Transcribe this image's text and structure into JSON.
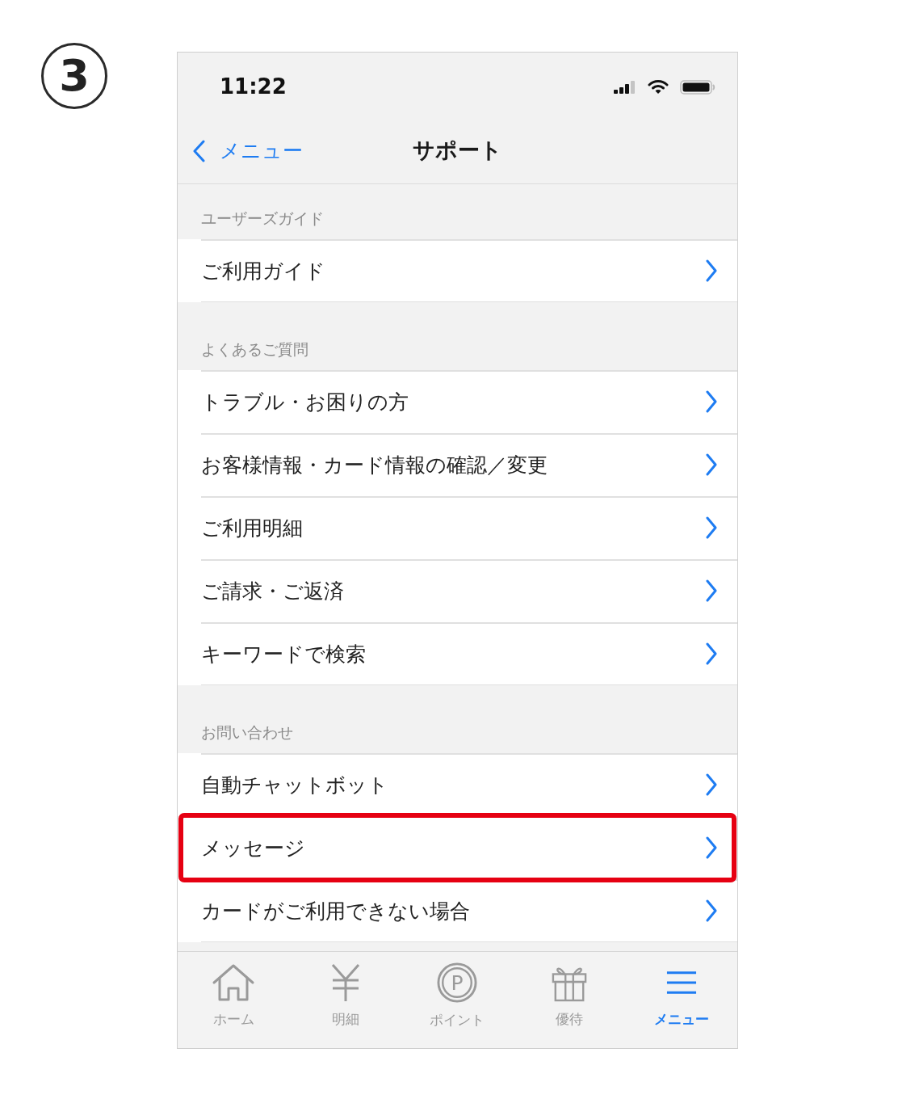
{
  "step_number": "3",
  "status_bar": {
    "time": "11:22"
  },
  "nav_bar": {
    "back_label": "メニュー",
    "title": "サポート"
  },
  "sections": [
    {
      "header": "ユーザーズガイド",
      "rows": [
        {
          "label": "ご利用ガイド",
          "highlighted": false
        }
      ]
    },
    {
      "header": "よくあるご質問",
      "rows": [
        {
          "label": "トラブル・お困りの方",
          "highlighted": false
        },
        {
          "label": "お客様情報・カード情報の確認／変更",
          "highlighted": false
        },
        {
          "label": "ご利用明細",
          "highlighted": false
        },
        {
          "label": "ご請求・ご返済",
          "highlighted": false
        },
        {
          "label": "キーワードで検索",
          "highlighted": false
        }
      ]
    },
    {
      "header": "お問い合わせ",
      "rows": [
        {
          "label": "自動チャットボット",
          "highlighted": false
        },
        {
          "label": "メッセージ",
          "highlighted": true
        },
        {
          "label": "カードがご利用できない場合",
          "highlighted": false
        }
      ]
    }
  ],
  "tab_bar": [
    {
      "kind": "home",
      "label": "ホーム",
      "selected": false
    },
    {
      "kind": "yen",
      "label": "明細",
      "selected": false
    },
    {
      "kind": "coin",
      "icon_letter": "P",
      "label": "ポイント",
      "selected": false
    },
    {
      "kind": "gift",
      "label": "優待",
      "selected": false
    },
    {
      "kind": "menu",
      "label": "メニュー",
      "selected": true
    }
  ]
}
